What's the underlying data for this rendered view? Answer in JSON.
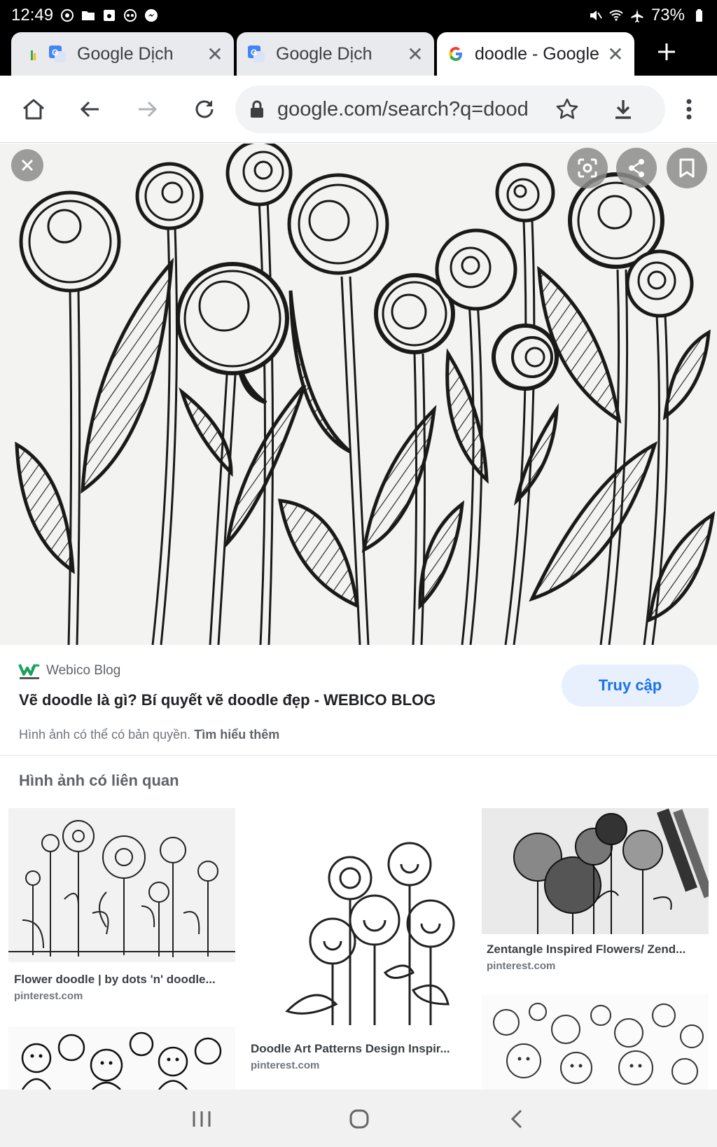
{
  "status_bar": {
    "time": "12:49",
    "battery": "73%",
    "left_icons": [
      "google-photos-icon",
      "folder-icon",
      "save-icon",
      "assistant-icon",
      "messenger-icon"
    ],
    "right_icons": [
      "mute-icon",
      "wifi-icon",
      "airplane-mode-icon",
      "battery-icon"
    ]
  },
  "tabs": [
    {
      "title": "Google Dịch",
      "active": false,
      "icon": "google-translate-icon"
    },
    {
      "title": "Google Dịch",
      "active": false,
      "icon": "google-translate-icon"
    },
    {
      "title": "doodle - Google",
      "active": true,
      "icon": "google-g-icon"
    }
  ],
  "toolbar": {
    "url": "google.com/search?q=dood"
  },
  "source": {
    "site_name": "Webico Blog",
    "title": "Vẽ doodle là gì? Bí quyết vẽ doodle đẹp - WEBICO BLOG",
    "visit_label": "Truy cập",
    "copyright_text": "Hình ảnh có thể có bản quyền.",
    "learn_more": "Tìm hiểu thêm"
  },
  "related": {
    "title": "Hình ảnh có liên quan",
    "items": [
      {
        "caption": "Flower doodle | by dots 'n' doodle...",
        "source": "pinterest.com"
      },
      {
        "caption": "Doodle Art Patterns Design Inspir...",
        "source": "pinterest.com"
      },
      {
        "caption": "Zentangle Inspired Flowers/ Zend...",
        "source": "pinterest.com"
      }
    ]
  },
  "colors": {
    "accent": "#1a73e8",
    "visit_bg": "#e8f0fe",
    "omnibox_bg": "#f1f3f4",
    "tab_inactive": "#e8eaed"
  }
}
